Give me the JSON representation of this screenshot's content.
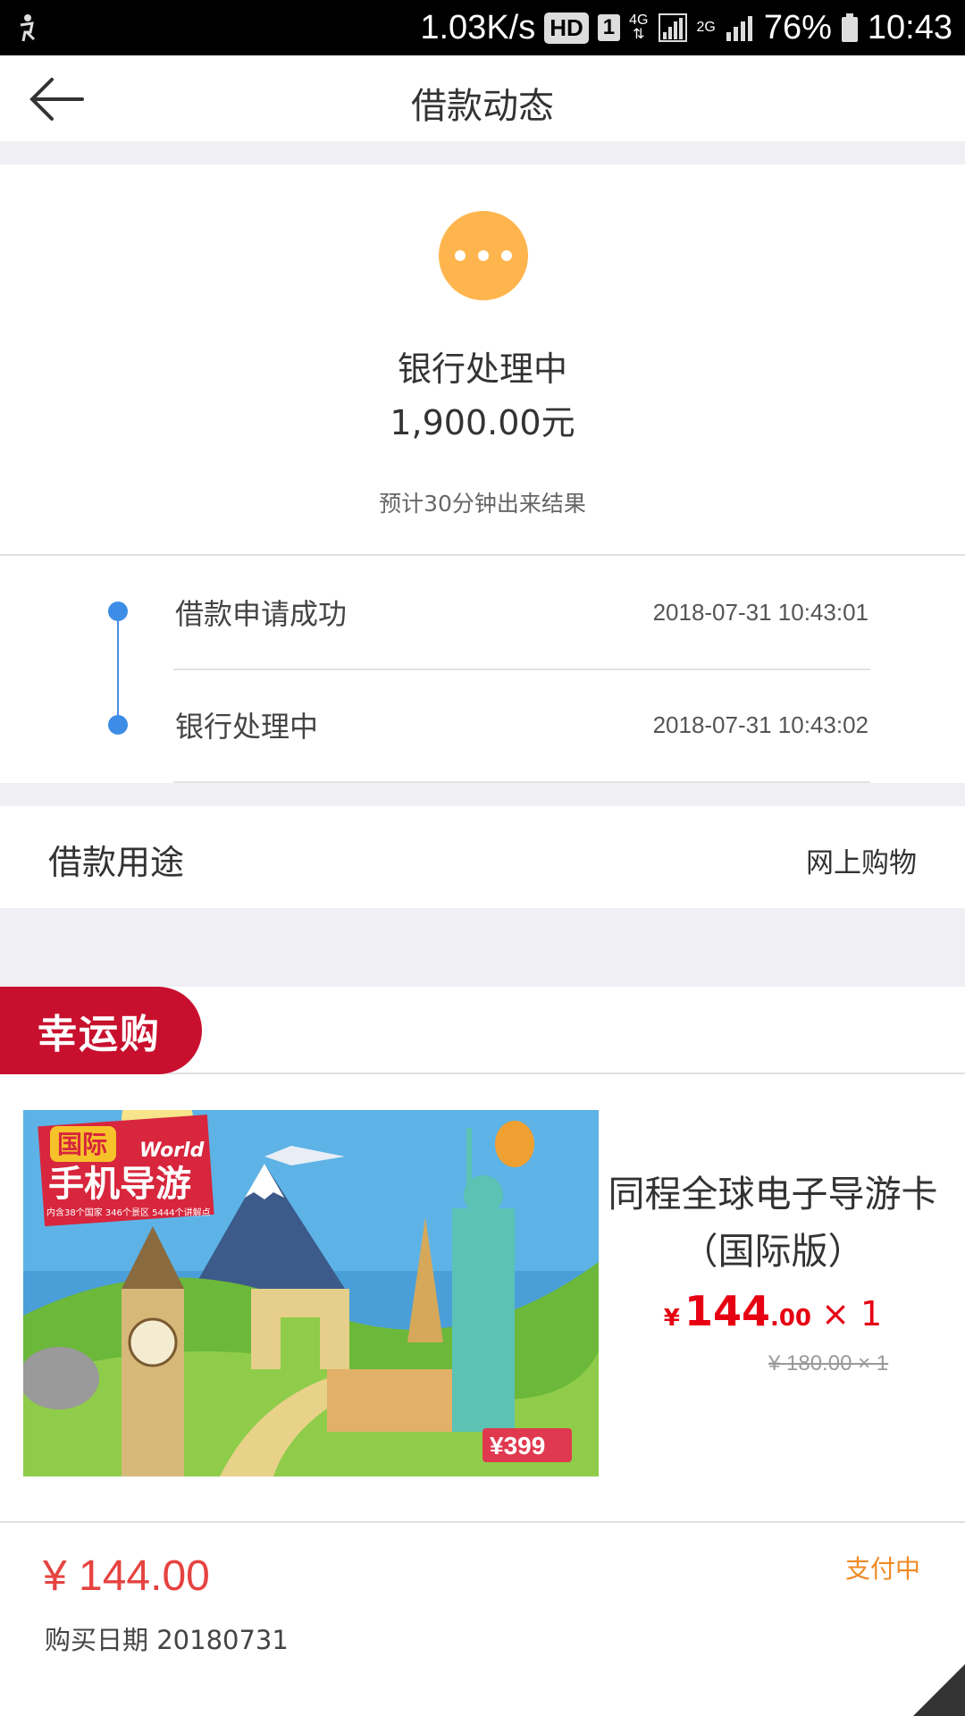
{
  "statusbar": {
    "speed": "1.03K/s",
    "hd": "HD",
    "sim": "1",
    "net": "4G",
    "net2": "2G",
    "battery": "76%",
    "time": "10:43"
  },
  "header": {
    "title": "借款动态"
  },
  "status": {
    "state": "银行处理中",
    "amount": "1,900.00元",
    "eta": "预计30分钟出来结果",
    "accent_color": "#ffb54d"
  },
  "timeline": [
    {
      "label": "借款申请成功",
      "time": "2018-07-31 10:43:01"
    },
    {
      "label": "银行处理中",
      "time": "2018-07-31 10:43:02"
    }
  ],
  "purpose": {
    "label": "借款用途",
    "value": "网上购物"
  },
  "lucky": {
    "tag": "幸运购"
  },
  "product": {
    "name": "同程全球电子导游卡（国际版）",
    "price_symbol": "¥",
    "price_int": "144",
    "price_dec": ".00",
    "price_mul": "× 1",
    "orig": "¥ 180.00 × 1",
    "image": {
      "badge_cn": "国际",
      "badge_en": "World",
      "title": "手机导游",
      "subtitle": "内含38个国家 346个景区 5444个讲解点",
      "price_tag": "¥399"
    }
  },
  "order": {
    "total": "¥ 144.00",
    "date": "购买日期 20180731",
    "status": "支付中",
    "status_color": "#f08a24"
  }
}
